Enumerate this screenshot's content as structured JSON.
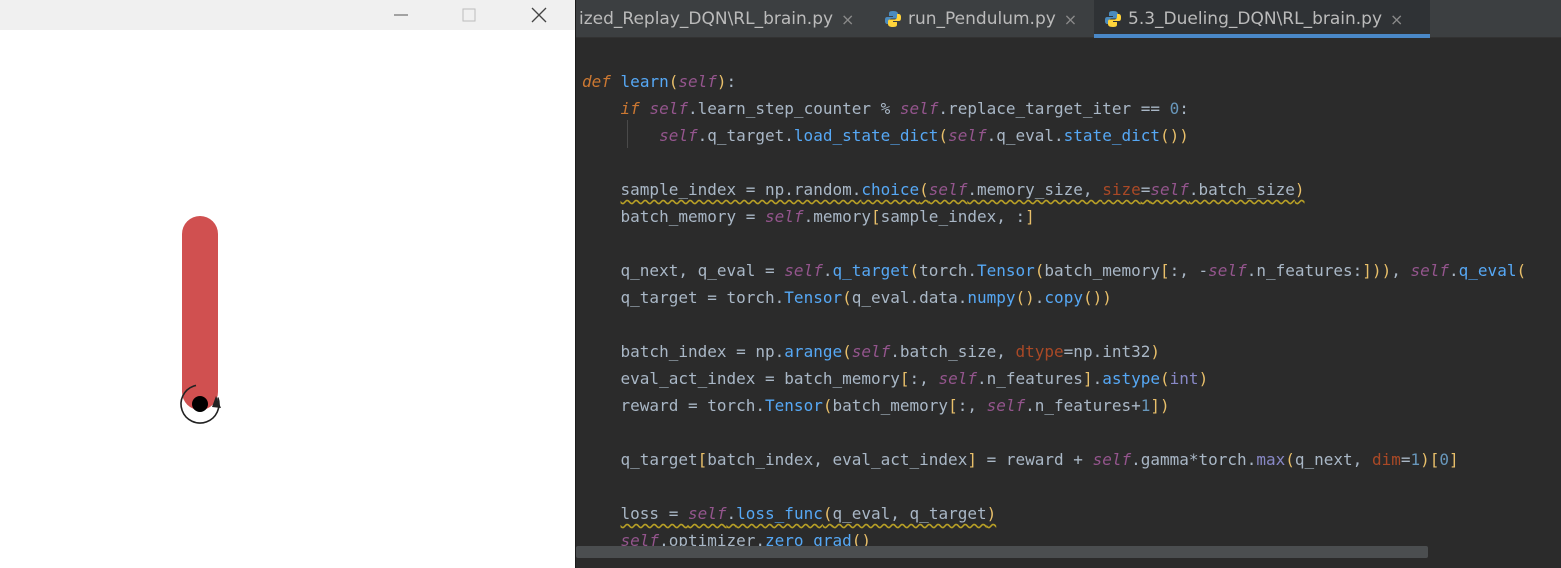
{
  "render_window": {
    "pendulum_color": "#d05050",
    "pivot_color": "#000000"
  },
  "editor": {
    "tabs": [
      {
        "label": "ized_Replay_DQN\\RL_brain.py",
        "active": false
      },
      {
        "label": "run_Pendulum.py",
        "active": false
      },
      {
        "label": "5.3_Dueling_DQN\\RL_brain.py",
        "active": true
      }
    ],
    "close_glyph": "×",
    "accent_color": "#4a88c7",
    "code_lines": [
      "def learn(self):",
      "    if self.learn_step_counter % self.replace_target_iter == 0:",
      "        self.q_target.load_state_dict(self.q_eval.state_dict())",
      "",
      "    sample_index = np.random.choice(self.memory_size, size=self.batch_size)",
      "    batch_memory = self.memory[sample_index, :]",
      "",
      "    q_next, q_eval = self.q_target(torch.Tensor(batch_memory[:, -self.n_features:])), self.q_eval(",
      "    q_target = torch.Tensor(q_eval.data.numpy().copy())",
      "",
      "    batch_index = np.arange(self.batch_size, dtype=np.int32)",
      "    eval_act_index = batch_memory[:, self.n_features].astype(int)",
      "    reward = torch.Tensor(batch_memory[:, self.n_features+1])",
      "",
      "    q_target[batch_index, eval_act_index] = reward + self.gamma*torch.max(q_next, dim=1)[0]",
      "",
      "    loss = self.loss_func(q_eval, q_target)",
      "    self.optimizer.zero_grad()"
    ]
  }
}
